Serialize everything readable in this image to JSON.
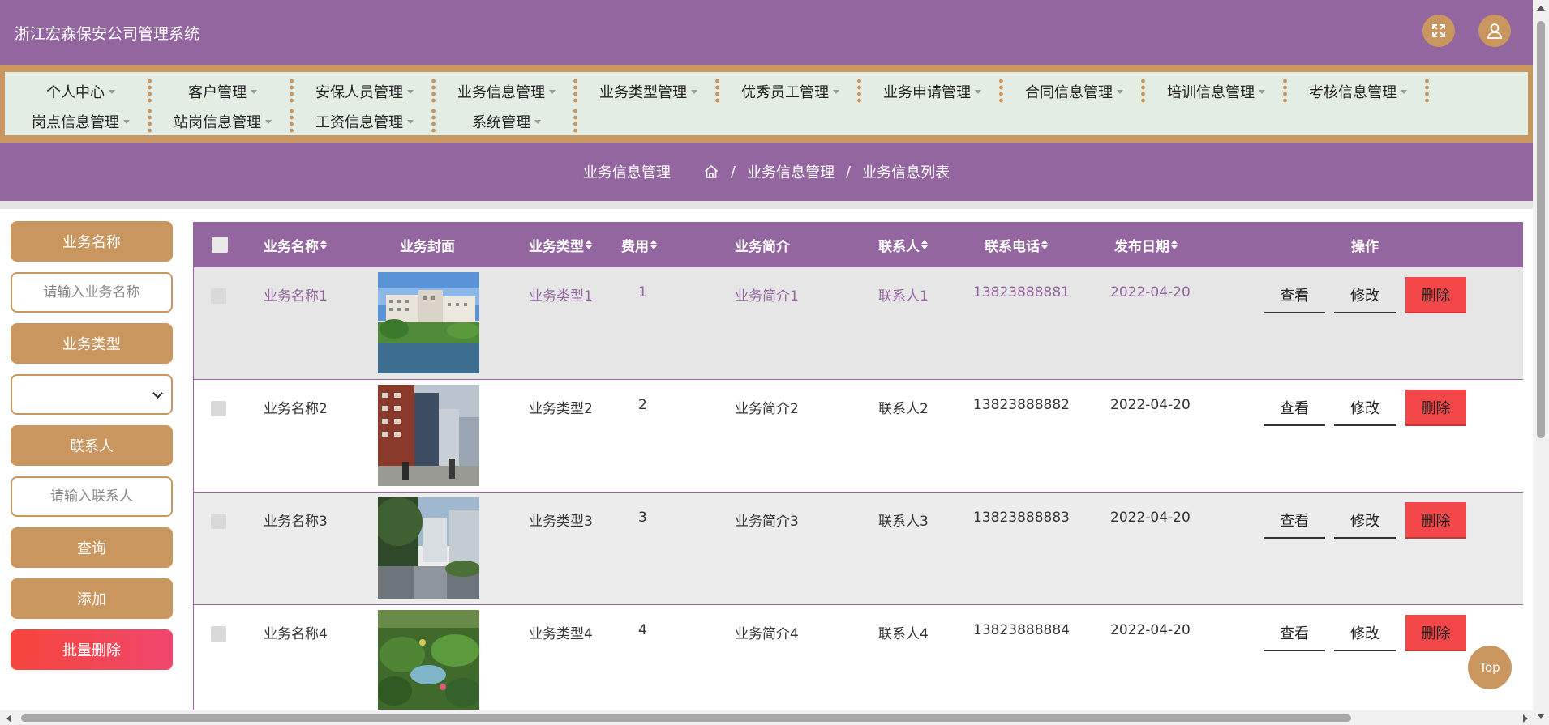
{
  "header": {
    "title": "浙江宏森保安公司管理系统",
    "fullscreen_icon": "expand-icon",
    "user_icon": "user-icon",
    "accent_color": "#93669f",
    "secondary_color": "#c8965e"
  },
  "nav": {
    "row1": [
      "个人中心",
      "客户管理",
      "安保人员管理",
      "业务信息管理",
      "业务类型管理",
      "优秀员工管理",
      "业务申请管理",
      "合同信息管理",
      "培训信息管理",
      "考核信息管理"
    ],
    "row2": [
      "岗点信息管理",
      "站岗信息管理",
      "工资信息管理",
      "系统管理"
    ]
  },
  "breadcrumb": {
    "page_title": "业务信息管理",
    "path_1": "业务信息管理",
    "separator": "/",
    "path_2": "业务信息列表"
  },
  "search": {
    "name_label": "业务名称",
    "name_placeholder": "请输入业务名称",
    "type_label": "业务类型",
    "type_value": "",
    "contact_label": "联系人",
    "contact_placeholder": "请输入联系人",
    "query_btn": "查询",
    "add_btn": "添加",
    "batch_delete_btn": "批量删除"
  },
  "table": {
    "columns": {
      "name": "业务名称",
      "cover": "业务封面",
      "type": "业务类型",
      "fee": "费用",
      "intro": "业务简介",
      "contact": "联系人",
      "phone": "联系电话",
      "date": "发布日期",
      "ops": "操作"
    },
    "rows": [
      {
        "name": "业务名称1",
        "type": "业务类型1",
        "fee": "1",
        "intro": "业务简介1",
        "contact": "联系人1",
        "phone": "13823888881",
        "date": "2022-04-20",
        "view": "查看",
        "edit": "修改",
        "delete": "删除"
      },
      {
        "name": "业务名称2",
        "type": "业务类型2",
        "fee": "2",
        "intro": "业务简介2",
        "contact": "联系人2",
        "phone": "13823888882",
        "date": "2022-04-20",
        "view": "查看",
        "edit": "修改",
        "delete": "删除"
      },
      {
        "name": "业务名称3",
        "type": "业务类型3",
        "fee": "3",
        "intro": "业务简介3",
        "contact": "联系人3",
        "phone": "13823888883",
        "date": "2022-04-20",
        "view": "查看",
        "edit": "修改",
        "delete": "删除"
      },
      {
        "name": "业务名称4",
        "type": "业务类型4",
        "fee": "4",
        "intro": "业务简介4",
        "contact": "联系人4",
        "phone": "13823888884",
        "date": "2022-04-20",
        "view": "查看",
        "edit": "修改",
        "delete": "删除"
      }
    ]
  },
  "top_button": "Top"
}
